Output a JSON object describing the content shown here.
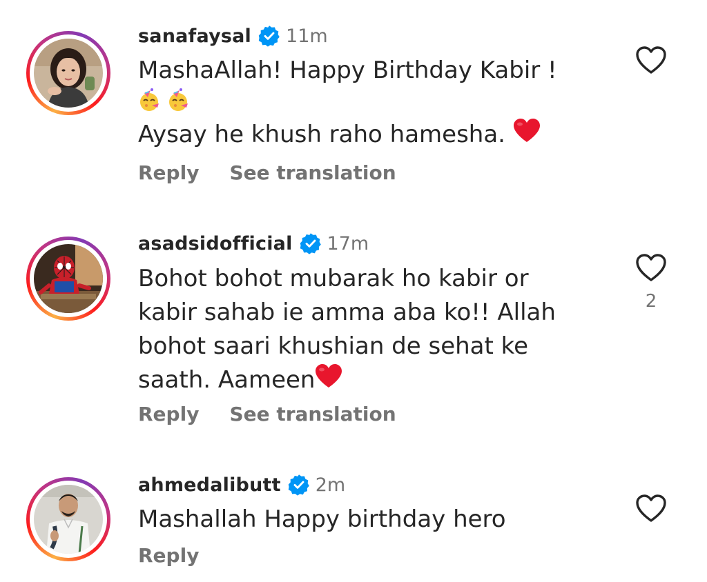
{
  "comments": [
    {
      "username": "sanafaysal",
      "time": "11m",
      "lines": [
        "MashaAllah! Happy Birthday Kabir !",
        "",
        "Aysay he khush raho hamesha."
      ],
      "emoji": [
        "partying-face",
        "partying-face",
        "red-heart"
      ],
      "actions": {
        "reply": "Reply",
        "translate": "See translation"
      },
      "likes": ""
    },
    {
      "username": "asadsidofficial",
      "time": "17m",
      "lines": [
        "Bohot bohot mubarak ho kabir or",
        "kabir sahab ie amma aba ko!! Allah",
        "bohot saari khushian de sehat ke",
        "saath. Aameen"
      ],
      "emoji": [
        "red-heart"
      ],
      "actions": {
        "reply": "Reply",
        "translate": "See translation"
      },
      "likes": "2"
    },
    {
      "username": "ahmedalibutt",
      "time": "2m",
      "lines": [
        "Mashallah Happy birthday hero"
      ],
      "actions": {
        "reply": "Reply"
      },
      "likes": ""
    }
  ],
  "colors": {
    "text": "#262626",
    "secondary": "#737373",
    "verified": "#0095f6",
    "heart": "#e8162d"
  },
  "icons": {
    "verified": "verified-badge-icon",
    "like": "heart-outline-icon"
  }
}
